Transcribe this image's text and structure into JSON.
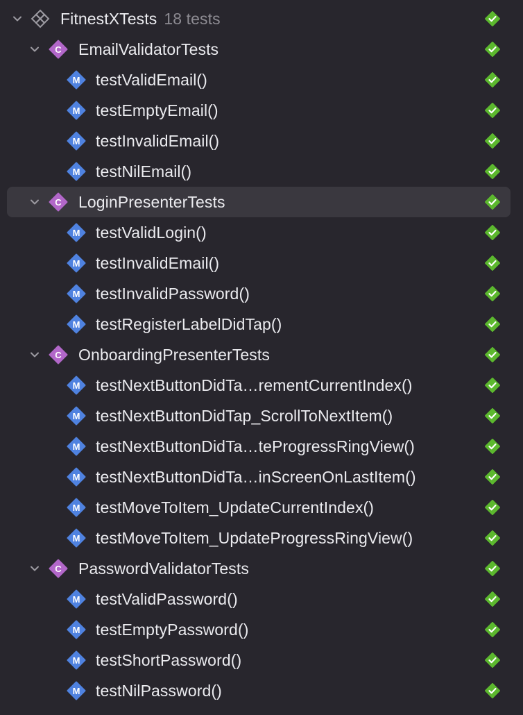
{
  "root": {
    "name": "FitnestXTests",
    "count": "18 tests",
    "icon": "test-target-icon",
    "status": "passed"
  },
  "suites": [
    {
      "name": "EmailValidatorTests",
      "icon": "class-icon",
      "status": "passed",
      "tests": [
        {
          "name": "testValidEmail()",
          "status": "passed"
        },
        {
          "name": "testEmptyEmail()",
          "status": "passed"
        },
        {
          "name": "testInvalidEmail()",
          "status": "passed"
        },
        {
          "name": "testNilEmail()",
          "status": "passed"
        }
      ]
    },
    {
      "name": "LoginPresenterTests",
      "icon": "class-icon",
      "status": "passed",
      "selected": true,
      "tests": [
        {
          "name": "testValidLogin()",
          "status": "passed"
        },
        {
          "name": "testInvalidEmail()",
          "status": "passed"
        },
        {
          "name": "testInvalidPassword()",
          "status": "passed"
        },
        {
          "name": "testRegisterLabelDidTap()",
          "status": "passed"
        }
      ]
    },
    {
      "name": "OnboardingPresenterTests",
      "icon": "class-icon",
      "status": "passed",
      "tests": [
        {
          "name": "testNextButtonDidTa…rementCurrentIndex()",
          "status": "passed"
        },
        {
          "name": "testNextButtonDidTap_ScrollToNextItem()",
          "status": "passed"
        },
        {
          "name": "testNextButtonDidTa…teProgressRingView()",
          "status": "passed"
        },
        {
          "name": "testNextButtonDidTa…inScreenOnLastItem()",
          "status": "passed"
        },
        {
          "name": "testMoveToItem_UpdateCurrentIndex()",
          "status": "passed"
        },
        {
          "name": "testMoveToItem_UpdateProgressRingView()",
          "status": "passed"
        }
      ]
    },
    {
      "name": "PasswordValidatorTests",
      "icon": "class-icon",
      "status": "passed",
      "tests": [
        {
          "name": "testValidPassword()",
          "status": "passed"
        },
        {
          "name": "testEmptyPassword()",
          "status": "passed"
        },
        {
          "name": "testShortPassword()",
          "status": "passed"
        },
        {
          "name": "testNilPassword()",
          "status": "passed"
        }
      ]
    }
  ],
  "badges": {
    "class_letter": "C",
    "method_letter": "M"
  },
  "colors": {
    "background": "#28262d",
    "selection": "#3a383f",
    "text": "#ebebef",
    "secondary_text": "#8d8b92",
    "class_badge": "#b267c9",
    "method_badge": "#4f82e0",
    "pass": "#5cb82e",
    "chevron": "#9d9ba2"
  }
}
